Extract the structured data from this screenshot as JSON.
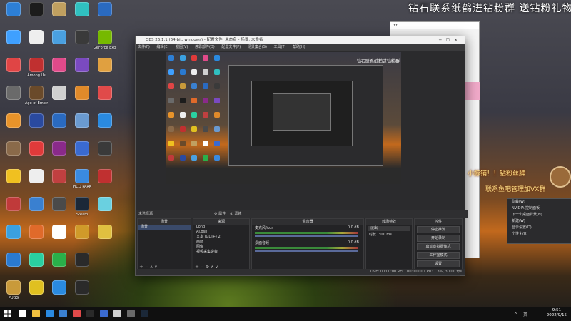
{
  "banner": "钻石联系纸鹤进钻粉群 送钻粉礼物",
  "desktop_icons": [
    {
      "label": "",
      "color": "#2d7fd6"
    },
    {
      "label": "",
      "color": "#3fa0ff"
    },
    {
      "label": "",
      "color": "#e04545"
    },
    {
      "label": "",
      "color": "#6a6a6a"
    },
    {
      "label": "",
      "color": "#e8932a"
    },
    {
      "label": "",
      "color": "#8a6a4a"
    },
    {
      "label": "",
      "color": "#f0c020"
    },
    {
      "label": "",
      "color": "#c03a3a"
    },
    {
      "label": "",
      "color": "#3aa0e0"
    },
    {
      "label": "",
      "color": "#2a7ad0"
    },
    {
      "label": "PUBG",
      "color": "#c99a3a"
    },
    {
      "label": "",
      "color": "#1c1c1c"
    },
    {
      "label": "",
      "color": "#eeeeee"
    },
    {
      "label": "Among Us",
      "color": "#c03030"
    },
    {
      "label": "Age of Empires IV",
      "color": "#6a4a2a"
    },
    {
      "label": "",
      "color": "#2a4aa0"
    },
    {
      "label": "",
      "color": "#e03a3a"
    },
    {
      "label": "",
      "color": "#eeeeee"
    },
    {
      "label": "",
      "color": "#3a80d0"
    },
    {
      "label": "",
      "color": "#e06a2a"
    },
    {
      "label": "",
      "color": "#2ad0a0"
    },
    {
      "label": "",
      "color": "#e0c020"
    },
    {
      "label": "",
      "color": "#c0a060"
    },
    {
      "label": "",
      "color": "#4aa0e0"
    },
    {
      "label": "",
      "color": "#e04a8a"
    },
    {
      "label": "",
      "color": "#d0d0d0"
    },
    {
      "label": "",
      "color": "#2a6ac0"
    },
    {
      "label": "",
      "color": "#8a2a8a"
    },
    {
      "label": "",
      "color": "#c04040"
    },
    {
      "label": "",
      "color": "#4a4a4a"
    },
    {
      "label": "",
      "color": "#ffffff"
    },
    {
      "label": "",
      "color": "#2ab04a"
    },
    {
      "label": "",
      "color": "#2a8ae0"
    },
    {
      "label": "",
      "color": "#30c0c0"
    },
    {
      "label": "",
      "color": "#3a3a3a"
    },
    {
      "label": "",
      "color": "#7a4ac0"
    },
    {
      "label": "",
      "color": "#e08a2a"
    },
    {
      "label": "",
      "color": "#6a9ad0"
    },
    {
      "label": "",
      "color": "#3a6ad0"
    },
    {
      "label": "PICO PARK",
      "color": "#3a8ae0"
    },
    {
      "label": "Steam",
      "color": "#1b2838"
    },
    {
      "label": "",
      "color": "#d09a2a"
    },
    {
      "label": "",
      "color": "#2a2a2a"
    },
    {
      "label": "",
      "color": "#2a2a2a"
    },
    {
      "label": "",
      "color": "#2a6ac0"
    },
    {
      "label": "GeForce Experience",
      "color": "#76b900"
    },
    {
      "label": "",
      "color": "#e0a040"
    },
    {
      "label": "",
      "color": "#e04a4a"
    },
    {
      "label": "",
      "color": "#2a8ae0"
    },
    {
      "label": "",
      "color": "#3a3a3a"
    },
    {
      "label": "",
      "color": "#c03030"
    },
    {
      "label": "",
      "color": "#6ad0e0"
    },
    {
      "label": "",
      "color": "#e0c040"
    }
  ],
  "obs": {
    "title": "OBS 26.1.1 (64-bit, windows) - 配置文件: 未命名 - 场景: 未命名",
    "menu": [
      "文件(F)",
      "编辑(E)",
      "视图(V)",
      "停靠部件(D)",
      "配置文件(P)",
      "场景集合(S)",
      "工具(T)",
      "帮助(H)"
    ],
    "preview_overlay_text": "钻石联系纸鹤进钻粉群 送钻粉礼物",
    "header_no_source": "未选择源",
    "modes": [
      "属性",
      "滤镜"
    ],
    "docks": {
      "scenes": {
        "title": "场景",
        "items": [
          "场景"
        ]
      },
      "sources": {
        "title": "来源",
        "items": [
          "Long",
          "AI.gsn",
          "文本 (GDI+) 2",
          "画面",
          "图像",
          "视频采集设备"
        ]
      },
      "mixer": {
        "title": "混音器",
        "channels": [
          {
            "name": "麦克风/Aux",
            "db": "0.0 dB"
          },
          {
            "name": "桌面音频",
            "db": "0.0 dB"
          }
        ]
      },
      "transitions": {
        "title": "转场特效",
        "type": "淡出",
        "duration_label": "时长",
        "duration": "300 ms"
      },
      "controls": {
        "title": "控件",
        "buttons": [
          "停止推流",
          "开始录制",
          "启动虚拟摄像机",
          "工作室模式",
          "设置",
          "退出"
        ]
      }
    },
    "status": "LIVE: 00:00:00   REC: 00:00:00   CPU: 1.3%, 30.00 fps"
  },
  "yy": {
    "title": "YY"
  },
  "overlay": {
    "line1": "小鲸铺！！钻粉丝牌",
    "line2": "联系鱼吧管理加VX群"
  },
  "tray_menu": {
    "items": [
      "隐藏(W)",
      "NVIDIA 控制面板",
      "下一个桌面背景(N)",
      "新建(W)",
      "显示设置(D)",
      "个性化(R)"
    ]
  },
  "taskbar": {
    "time": "9:51",
    "date": "2022/9/15",
    "tray": "^ 英",
    "app_colors": [
      "#ffffff",
      "#f0c040",
      "#2a8ae0",
      "#3a80d0",
      "#e04a4a",
      "#2a2a2a",
      "#3a6ad0",
      "#d0d0d0",
      "#6a6a6a",
      "#1b2838"
    ]
  }
}
